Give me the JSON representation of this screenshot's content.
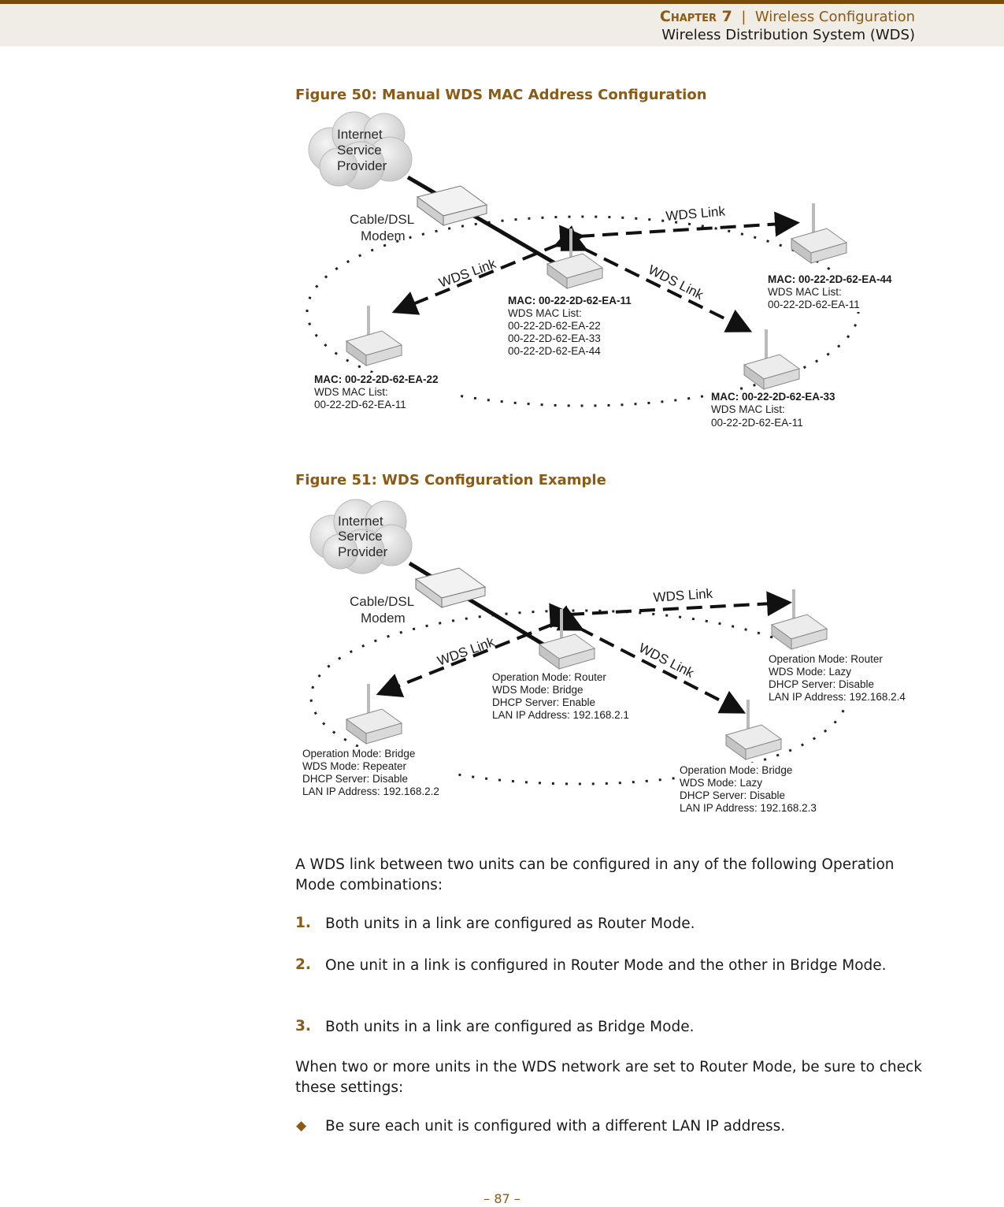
{
  "header": {
    "chapter_label": "Chapter 7",
    "separator": "|",
    "chapter_title": "Wireless Configuration",
    "section_title": "Wireless Distribution System (WDS)"
  },
  "figure50": {
    "title": "Figure 50:  Manual WDS MAC Address Configuration",
    "isp_lines": [
      "Internet",
      "Service",
      "Provider"
    ],
    "modem_lines": [
      "Cable/DSL",
      "Modem"
    ],
    "link_label": "WDS Link",
    "units": {
      "center": {
        "mac": "MAC: 00-22-2D-62-EA-11",
        "list_label": "WDS MAC List:",
        "list": [
          "00-22-2D-62-EA-22",
          "00-22-2D-62-EA-33",
          "00-22-2D-62-EA-44"
        ]
      },
      "left": {
        "mac": "MAC: 00-22-2D-62-EA-22",
        "list_label": "WDS MAC List:",
        "list": [
          "00-22-2D-62-EA-11"
        ]
      },
      "right_top": {
        "mac": "MAC: 00-22-2D-62-EA-44",
        "list_label": "WDS MAC List:",
        "list": [
          "00-22-2D-62-EA-11"
        ]
      },
      "right_bottom": {
        "mac": "MAC: 00-22-2D-62-EA-33",
        "list_label": "WDS MAC List:",
        "list": [
          "00-22-2D-62-EA-11"
        ]
      }
    }
  },
  "figure51": {
    "title": "Figure 51:  WDS Configuration Example",
    "isp_lines": [
      "Internet",
      "Service",
      "Provider"
    ],
    "modem_lines": [
      "Cable/DSL",
      "Modem"
    ],
    "link_label": "WDS Link",
    "units": {
      "center": [
        "Operation Mode: Router",
        "WDS Mode: Bridge",
        "DHCP Server: Enable",
        "LAN IP Address: 192.168.2.1"
      ],
      "left": [
        "Operation Mode: Bridge",
        "WDS Mode: Repeater",
        "DHCP Server: Disable",
        "LAN IP Address: 192.168.2.2"
      ],
      "right_top": [
        "Operation Mode: Router",
        "WDS Mode: Lazy",
        "DHCP Server: Disable",
        "LAN IP Address: 192.168.2.4"
      ],
      "right_bottom": [
        "Operation Mode: Bridge",
        "WDS Mode: Lazy",
        "DHCP Server: Disable",
        "LAN IP Address: 192.168.2.3"
      ]
    }
  },
  "body": {
    "intro": "A WDS link between two units can be configured in any of the following Operation Mode combinations:",
    "list": [
      {
        "num": "1.",
        "text": "Both units in a link are configured as Router Mode."
      },
      {
        "num": "2.",
        "text": "One unit in a link is configured in Router Mode and the other in Bridge Mode."
      },
      {
        "num": "3.",
        "text": "Both units in a link are configured as Bridge Mode."
      }
    ],
    "note": "When two or more units in the WDS network are set to Router Mode, be sure to check these settings:",
    "bullets": [
      {
        "symbol": "◆",
        "text": "Be sure each unit is configured with a different LAN IP address."
      }
    ]
  },
  "footer": {
    "page_number": "–  87  –"
  }
}
